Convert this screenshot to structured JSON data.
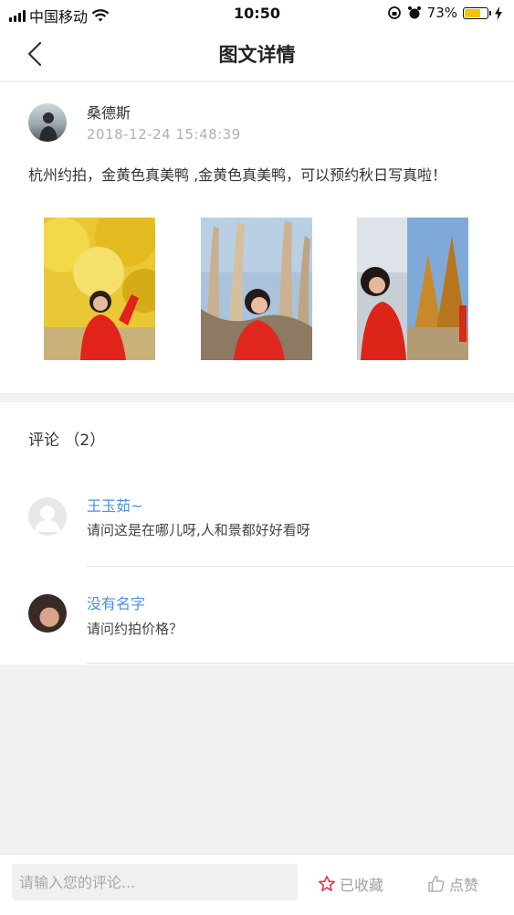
{
  "status_bar": {
    "carrier": "中国移动",
    "time": "10:50",
    "battery_percent": "73%",
    "battery_level": 0.73,
    "battery_color": "#f5c400"
  },
  "nav": {
    "title": "图文详情",
    "back_icon": "chevron-left-icon"
  },
  "post": {
    "author": "桑德斯",
    "timestamp": "2018-12-24   15:48:39",
    "text": "杭州约拍，金黄色真美鸭 ,金黄色真美鸭，可以预约秋日写真啦！",
    "photos": [
      "photo-1",
      "photo-2",
      "photo-3"
    ]
  },
  "comments": {
    "header": "评论 （2）",
    "items": [
      {
        "name": "王玉茹~",
        "text": "请问这是在哪儿呀,人和景都好好看呀"
      },
      {
        "name": "没有名字",
        "text": "请问约拍价格？"
      }
    ]
  },
  "bottom_bar": {
    "input_placeholder": "请输入您的评论...",
    "favorite_label": "已收藏",
    "like_label": "点赞",
    "accent_color": "#e8364f"
  }
}
